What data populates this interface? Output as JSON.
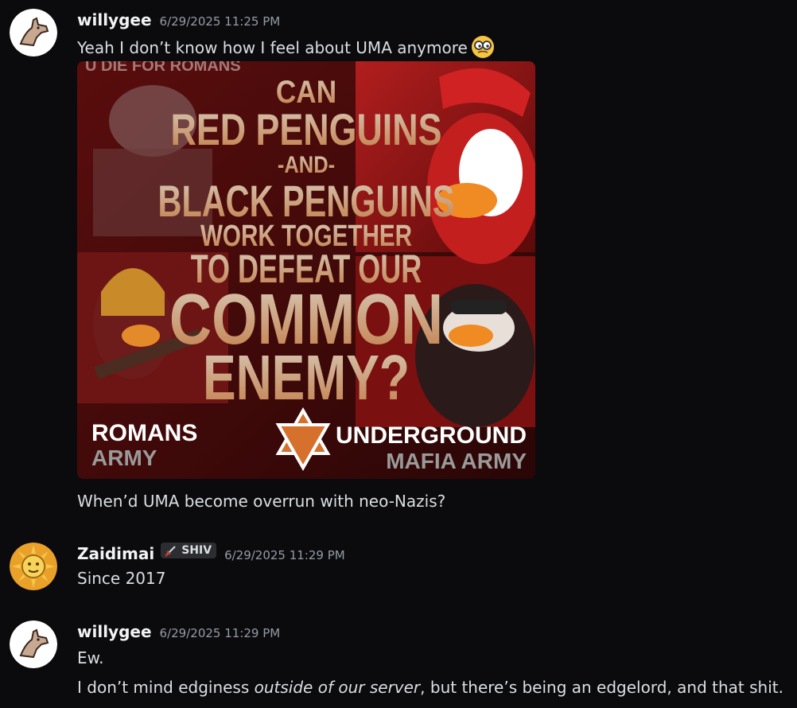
{
  "messages": [
    {
      "username": "willygee",
      "timestamp": "6/29/2025 11:25 PM",
      "text": "Yeah I don’t know how I feel about UMA anymore",
      "emoji": "nerd-face-emoji",
      "image": {
        "top_text": "U DIE FOR ROMANS",
        "lines": [
          "CAN",
          "RED PENGUINS",
          "-AND-",
          "BLACK PENGUINS",
          "WORK TOGETHER",
          "TO DEFEAT OUR",
          "COMMON",
          "ENEMY?"
        ],
        "left_label_1": "ROMANS",
        "left_label_2": "ARMY",
        "right_label_1": "UNDERGROUND",
        "right_label_2": "MAFIA ARMY"
      },
      "followup": "When’d UMA become overrun with neo-Nazis?"
    },
    {
      "username": "Zaidimai",
      "badge": "SHIV",
      "timestamp": "6/29/2025 11:29 PM",
      "text": "Since 2017"
    },
    {
      "username": "willygee",
      "timestamp": "6/29/2025 11:29 PM",
      "text": "Ew.",
      "followup_before": "I don’t mind edginess ",
      "followup_italic": "outside of our server",
      "followup_after": ", but there’s being an edgelord, and that shit."
    }
  ],
  "colors": {
    "background": "#0b0b0e",
    "username": "#f2f3f5",
    "timestamp": "#949ba4",
    "text": "#dbdee1"
  }
}
